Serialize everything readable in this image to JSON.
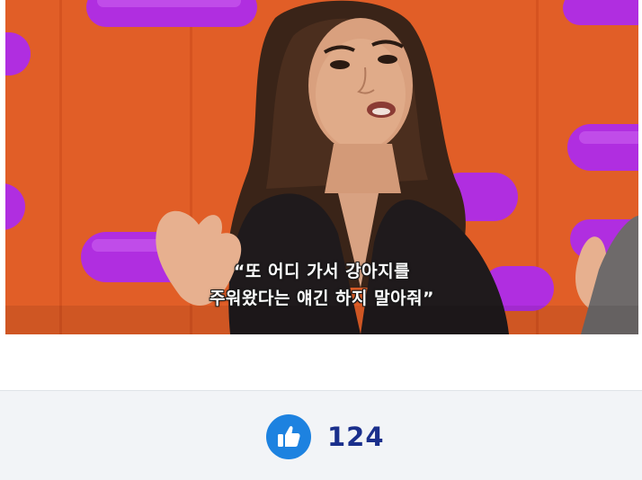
{
  "media": {
    "subtitle_line1": "“또 어디 가서 강아지를",
    "subtitle_line2": "주워왔다는 얘긴 하지 말아줘”",
    "background_color": "#e5622a",
    "accent_color": "#b02ee0"
  },
  "reaction": {
    "icon": "thumbs-up-icon",
    "count": "124",
    "icon_color": "#1d82e0",
    "count_color": "#1a2f8c"
  }
}
